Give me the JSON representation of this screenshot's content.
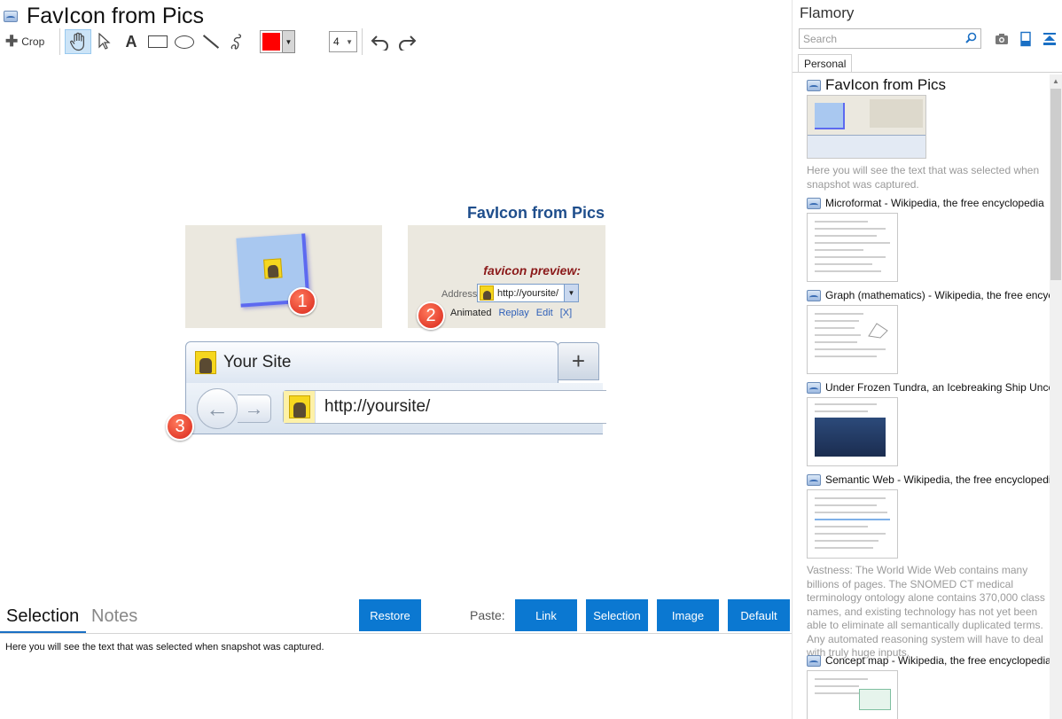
{
  "editor": {
    "title": "FavIcon from Pics",
    "toolbar": {
      "crop_label": "Crop",
      "line_width": "4",
      "color": "#ff0000"
    }
  },
  "snapshot": {
    "title": "FavIcon from Pics",
    "favicon_preview_label": "favicon preview:",
    "address_label": "Address",
    "address_value": "http://yoursite/",
    "links": {
      "animated": "Animated",
      "replay": "Replay",
      "edit": "Edit",
      "close": "[X]"
    },
    "badges": [
      "1",
      "2",
      "3"
    ],
    "tab_title": "Your Site",
    "new_tab": "+",
    "url": "http://yoursite/"
  },
  "bottom": {
    "tabs": {
      "selection": "Selection",
      "notes": "Notes"
    },
    "restore_label": "Restore",
    "paste_label": "Paste:",
    "paste_buttons": {
      "link": "Link",
      "selection": "Selection",
      "image": "Image",
      "default": "Default"
    },
    "selection_text": "Here you will see the text that was selected when snapshot was captured.",
    "accent": "#0b78d1"
  },
  "sidebar": {
    "app_name": "Flamory",
    "search_placeholder": "Search",
    "tab_personal": "Personal",
    "items": [
      {
        "title": "FavIcon from Pics",
        "desc": "Here you will see the text that was selected when snapshot was captured."
      },
      {
        "title": "Microformat - Wikipedia, the free encyclopedia",
        "desc": ""
      },
      {
        "title": "Graph (mathematics) - Wikipedia, the free encyclopedia",
        "desc": ""
      },
      {
        "title": "Under Frozen Tundra, an Icebreaking Ship Uncovers",
        "desc": ""
      },
      {
        "title": "Semantic Web - Wikipedia, the free encyclopedia",
        "desc": "Vastness: The World Wide Web contains many billions of pages. The SNOMED CT medical terminology ontology alone contains 370,000 class names, and existing technology has not yet been able to eliminate all semantically duplicated terms. Any automated reasoning system will have to deal with truly huge inputs."
      },
      {
        "title": "Concept map - Wikipedia, the free encyclopedia",
        "desc": ""
      }
    ]
  }
}
